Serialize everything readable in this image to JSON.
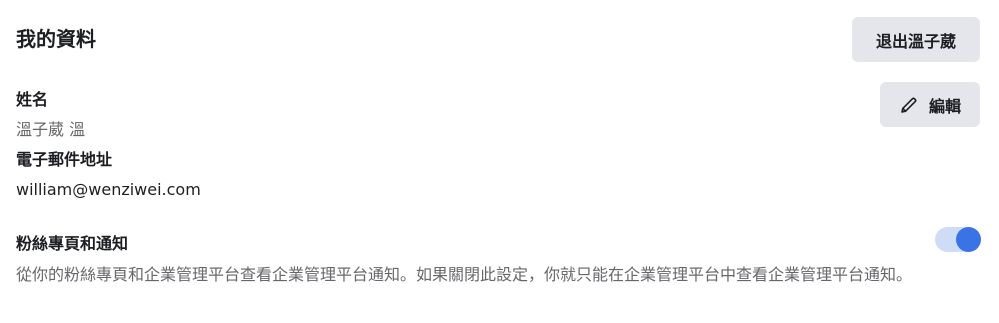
{
  "profile": {
    "title": "我的資料",
    "logout_label": "退出溫子葳",
    "edit_label": "編輯",
    "edit_icon": "pencil-icon",
    "name_label": "姓名",
    "name_value": "溫子葳 溫",
    "email_label": "電子郵件地址",
    "email_value": "william@wenziwei.com"
  },
  "notifications": {
    "label": "粉絲專頁和通知",
    "description": "從你的粉絲專頁和企業管理平台查看企業管理平台通知。如果關閉此設定，你就只能在企業管理平台中查看企業管理平台通知。",
    "toggle_on": true
  },
  "colors": {
    "button_bg": "#e4e6eb",
    "toggle_track": "#cfdcf6",
    "toggle_knob": "#3a73e6",
    "secondary_text": "#65676b"
  }
}
